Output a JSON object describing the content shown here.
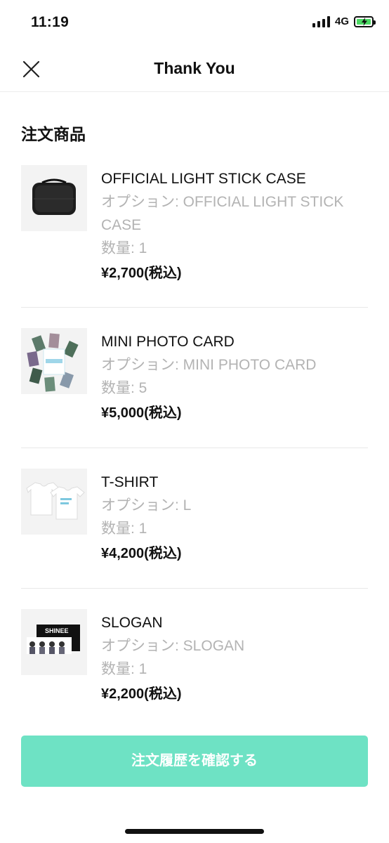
{
  "status_bar": {
    "time": "11:19",
    "network": "4G",
    "battery_color": "#4cd964"
  },
  "header": {
    "title": "Thank You",
    "close_icon": "close-icon"
  },
  "section": {
    "title": "注文商品"
  },
  "items": [
    {
      "name": "OFFICIAL LIGHT STICK CASE",
      "option_label": "オプション: ",
      "option_value": "OFFICIAL LIGHT STICK CASE",
      "quantity": "数量: 1",
      "price": "¥2,700(税込)"
    },
    {
      "name": "MINI PHOTO CARD",
      "option_label": "オプション: ",
      "option_value": "MINI PHOTO CARD",
      "quantity": "数量: 5",
      "price": "¥5,000(税込)"
    },
    {
      "name": "T-SHIRT",
      "option_label": "オプション: ",
      "option_value": "L",
      "quantity": "数量: 1",
      "price": "¥4,200(税込)"
    },
    {
      "name": "SLOGAN",
      "option_label": "オプション: ",
      "option_value": "SLOGAN",
      "quantity": "数量: 1",
      "price": "¥2,200(税込)",
      "thumb_text": "SHINEE"
    }
  ],
  "cta": {
    "label": "注文履歴を確認する",
    "color": "#6ee2c4"
  }
}
